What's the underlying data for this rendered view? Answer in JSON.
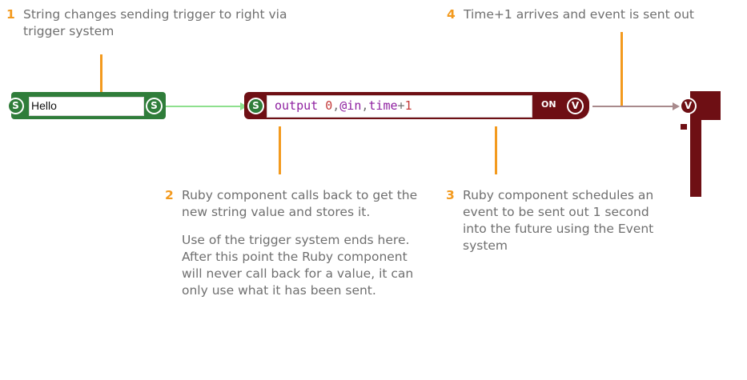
{
  "notes": [
    {
      "num": "1",
      "paragraphs": [
        "String changes sending trigger to right via trigger system"
      ]
    },
    {
      "num": "2",
      "paragraphs": [
        "Ruby component calls back to get the new string value and stores it.",
        "Use of the trigger system ends here. After this point the Ruby component will never call back for a value, it can only use what it has been sent."
      ]
    },
    {
      "num": "3",
      "paragraphs": [
        "Ruby component schedules an event to be sent out 1 second into the future using the Event system"
      ]
    },
    {
      "num": "4",
      "paragraphs": [
        "Time+1 arrives and event is sent out"
      ]
    }
  ],
  "string_component": {
    "value": "Hello",
    "in_connector": "S",
    "out_connector": "S"
  },
  "ruby_component": {
    "code_parts": {
      "kw": "output",
      "num": "0",
      "sep1": ",",
      "var": "@in",
      "sep2": ",",
      "time": "time",
      "plus": "+",
      "one": "1"
    },
    "in_connector": "S",
    "state_label": "ON",
    "out_connector": "V"
  },
  "target_component": {
    "in_connector": "V"
  },
  "colors": {
    "annotation_accent": "#f39a1e",
    "string_link": "#8ee08e",
    "event_link": "#a88a8c",
    "string_component": "#2f7d3a",
    "ruby_component": "#6e0f14"
  }
}
